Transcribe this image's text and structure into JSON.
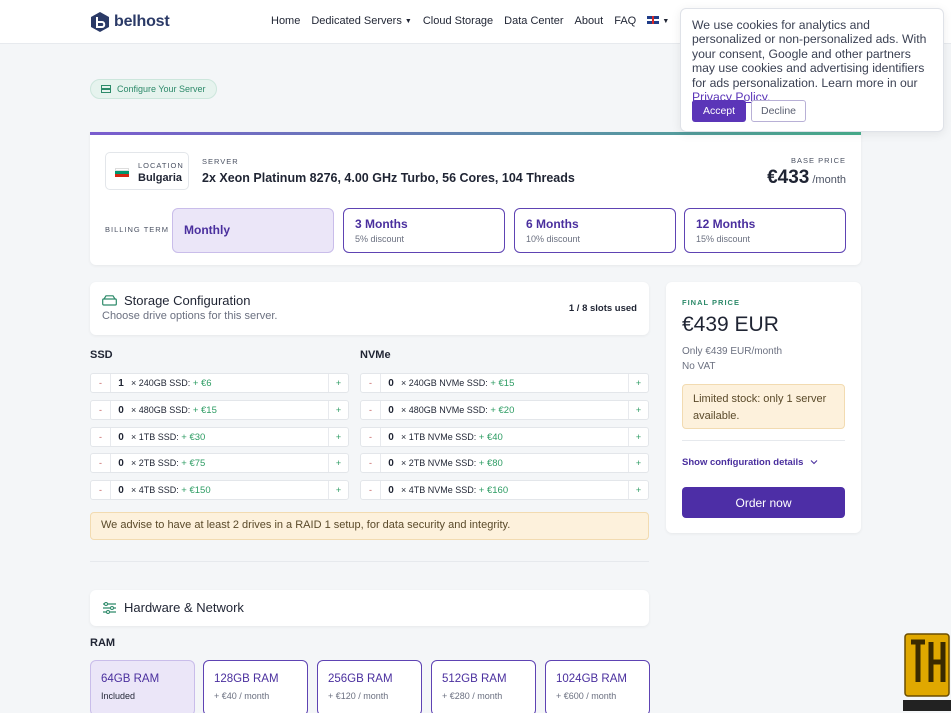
{
  "nav": {
    "brand": "belhost",
    "items": [
      "Home",
      "Dedicated Servers",
      "Cloud Storage",
      "Data Center",
      "About",
      "FAQ"
    ]
  },
  "cookie": {
    "text": "We use cookies for analytics and personalized or non-personalized ads. With your consent, Google and other partners may use cookies and advertising identifiers for ads personalization. Learn more in our ",
    "link": "Privacy Policy.",
    "accept": "Accept",
    "decline": "Decline"
  },
  "pill": {
    "label": "Configure Your Server"
  },
  "server": {
    "location_label": "LOCATION",
    "location": "Bulgaria",
    "server_label": "SERVER",
    "server_name": "2x Xeon Platinum 8276, 4.00 GHz Turbo, 56 Cores, 104 Threads",
    "base_price_label": "BASE PRICE",
    "base_price": "€433",
    "per": "/month",
    "billing_label": "BILLING TERM",
    "terms": [
      {
        "title": "Monthly",
        "sub": ""
      },
      {
        "title": "3 Months",
        "sub": "5% discount"
      },
      {
        "title": "6 Months",
        "sub": "10% discount"
      },
      {
        "title": "12 Months",
        "sub": "15% discount"
      }
    ]
  },
  "storage": {
    "title": "Storage Configuration",
    "subtitle": "Choose drive options for this server.",
    "used": "1 / 8 slots used",
    "ssd_label": "SSD",
    "nvme_label": "NVMe",
    "minus": "-",
    "plus": "+",
    "ssd": [
      {
        "qty": "1",
        "name": "× 240GB SSD:",
        "price": "+ €6"
      },
      {
        "qty": "0",
        "name": "× 480GB SSD:",
        "price": "+ €15"
      },
      {
        "qty": "0",
        "name": "× 1TB SSD:",
        "price": "+ €30"
      },
      {
        "qty": "0",
        "name": "× 2TB SSD:",
        "price": "+ €75"
      },
      {
        "qty": "0",
        "name": "× 4TB SSD:",
        "price": "+ €150"
      }
    ],
    "nvme": [
      {
        "qty": "0",
        "name": "× 240GB NVMe SSD:",
        "price": "+ €15"
      },
      {
        "qty": "0",
        "name": "× 480GB NVMe SSD:",
        "price": "+ €20"
      },
      {
        "qty": "0",
        "name": "× 1TB NVMe SSD:",
        "price": "+ €40"
      },
      {
        "qty": "0",
        "name": "× 2TB NVMe SSD:",
        "price": "+ €80"
      },
      {
        "qty": "0",
        "name": "× 4TB NVMe SSD:",
        "price": "+ €160"
      }
    ],
    "advise": "We advise to have at least 2 drives in a RAID 1 setup, for data security and integrity."
  },
  "hardware": {
    "title": "Hardware & Network",
    "ram_label": "RAM",
    "ram": [
      {
        "title": "64GB RAM",
        "sub": "Included"
      },
      {
        "title": "128GB RAM",
        "sub": "+ €40 / month"
      },
      {
        "title": "256GB RAM",
        "sub": "+ €120 / month"
      },
      {
        "title": "512GB RAM",
        "sub": "+ €280 / month"
      },
      {
        "title": "1024GB RAM",
        "sub": "+ €600 / month"
      }
    ]
  },
  "price": {
    "label": "FINAL PRICE",
    "value": "€439 EUR",
    "only": "Only €439 EUR/month",
    "vat": "No VAT",
    "stock": "Limited stock: only 1 server available.",
    "show": "Show configuration details",
    "order": "Order now"
  },
  "colors": {
    "accent": "#4d2ea6",
    "green": "#2d9c63"
  }
}
